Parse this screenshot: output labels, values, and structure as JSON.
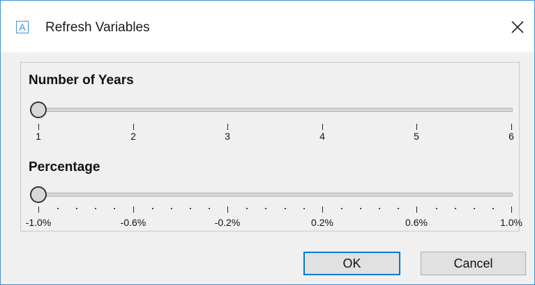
{
  "window": {
    "title": "Refresh Variables",
    "icon_letter": "A",
    "accent_color": "#3c8fd6"
  },
  "years": {
    "label": "Number of Years",
    "value": 1,
    "min": 1,
    "max": 6,
    "ticks": [
      "1",
      "2",
      "3",
      "4",
      "5",
      "6"
    ]
  },
  "percentage": {
    "label": "Percentage",
    "value": -1.0,
    "min": -1.0,
    "max": 1.0,
    "ticks": [
      "-1.0%",
      "-0.6%",
      "-0.2%",
      "0.2%",
      "0.6%",
      "1.0%"
    ]
  },
  "buttons": {
    "ok": "OK",
    "cancel": "Cancel"
  }
}
